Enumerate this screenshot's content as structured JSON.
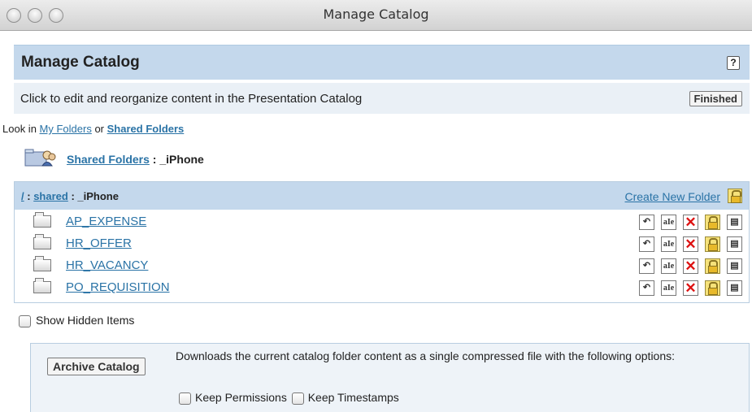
{
  "window": {
    "title": "Manage Catalog"
  },
  "header": {
    "title": "Manage Catalog",
    "help_label": "?"
  },
  "info": {
    "text": "Click to edit and reorganize content in the Presentation Catalog",
    "finished_label": "Finished"
  },
  "lookin": {
    "prefix": "Look in ",
    "my_folders": "My Folders",
    "or": " or ",
    "shared_folders": "Shared Folders"
  },
  "crumb": {
    "link": "Shared Folders",
    "sep": " : ",
    "folder": "_iPhone"
  },
  "list": {
    "path_root": "/",
    "path_sep1": " : ",
    "path_shared": "shared",
    "path_sep2": " : ",
    "path_folder": "_iPhone",
    "create_label": "Create New Folder",
    "items": [
      {
        "name": "AP_EXPENSE"
      },
      {
        "name": "HR_OFFER"
      },
      {
        "name": "HR_VACANCY"
      },
      {
        "name": "PO_REQUISITION"
      }
    ]
  },
  "hidden_items_label": "Show Hidden Items",
  "archive": {
    "button_label": "Archive Catalog",
    "description": "Downloads the current catalog folder content as a single compressed file with the following options:",
    "keep_permissions": "Keep Permissions",
    "keep_timestamps": "Keep Timestamps"
  }
}
